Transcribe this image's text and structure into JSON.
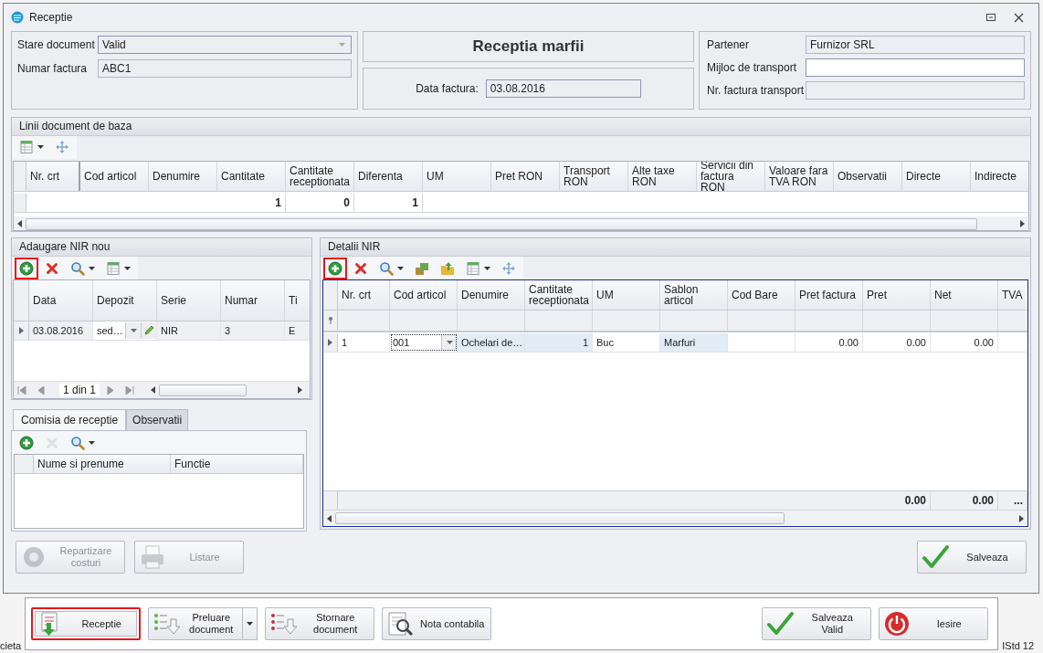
{
  "window": {
    "title": "Receptie"
  },
  "document": {
    "fields": [
      {
        "label": "Stare document",
        "value": "Valid",
        "kind": "dropdown"
      },
      {
        "label": "Numar factura",
        "value": "ABC1",
        "kind": "readonly"
      }
    ],
    "heading": "Receptia marfii",
    "date": {
      "label": "Data factura:",
      "value": "03.08.2016"
    },
    "partner_fields": [
      {
        "label": "Partener",
        "value": "Furnizor SRL",
        "kind": "readonly"
      },
      {
        "label": "Mijloc de transport",
        "kind": "editable"
      },
      {
        "label": "Nr. factura transport",
        "kind": "readonly"
      }
    ]
  },
  "base_lines": {
    "title": "Linii document de baza",
    "tools": [
      {
        "kind": "layout-menu",
        "highlighted": false,
        "disabled": false
      },
      {
        "kind": "move",
        "highlighted": false,
        "disabled": false
      }
    ],
    "columns": [
      {
        "label": "Nr. crt"
      },
      {
        "label": "Cod articol"
      },
      {
        "label": "Denumire"
      },
      {
        "label": "Cantitate",
        "total": "1"
      },
      {
        "label": "Cantitate receptionata",
        "total": "0"
      },
      {
        "label": "Diferenta",
        "total": "1"
      },
      {
        "label": "UM"
      },
      {
        "label": "Pret RON"
      },
      {
        "label": "Transport RON"
      },
      {
        "label": "Alte taxe RON"
      },
      {
        "label": "Servicii din factura RON"
      },
      {
        "label": "Valoare fara TVA RON"
      },
      {
        "label": "Observatii"
      },
      {
        "label": "Directe"
      },
      {
        "label": "Indirecte"
      }
    ]
  },
  "nir_list": {
    "title": "Adaugare NIR nou",
    "tools": [
      {
        "kind": "add",
        "highlighted": true,
        "disabled": false
      },
      {
        "kind": "delete",
        "highlighted": false,
        "disabled": false
      },
      {
        "kind": "search-menu",
        "highlighted": false,
        "disabled": false
      },
      {
        "kind": "layout-menu",
        "highlighted": false,
        "disabled": false
      }
    ],
    "columns": [
      "Data",
      "Depozit",
      "Serie",
      "Numar",
      "Ti"
    ],
    "rows": [
      {
        "selected": true,
        "cells": [
          {
            "text": "03.08.2016",
            "kind": "text"
          },
          {
            "text": "sed…",
            "kind": "lookup-edit"
          },
          {
            "text": "NIR",
            "kind": "text"
          },
          {
            "text": "3",
            "kind": "text"
          },
          {
            "text": "E",
            "kind": "text"
          }
        ]
      }
    ],
    "pager": "1 din 1"
  },
  "commission": {
    "tabs": [
      {
        "label": "Comisia de receptie",
        "selected": true
      },
      {
        "label": "Observatii",
        "selected": false
      }
    ],
    "tools": [
      {
        "kind": "add",
        "highlighted": false,
        "disabled": false
      },
      {
        "kind": "delete",
        "highlighted": false,
        "disabled": true
      },
      {
        "kind": "search-menu",
        "highlighted": false,
        "disabled": false
      }
    ],
    "columns": [
      "Nume si prenume",
      "Functie"
    ]
  },
  "nir_details": {
    "title": "Detalii NIR",
    "tools": [
      {
        "kind": "add",
        "highlighted": true,
        "disabled": false
      },
      {
        "kind": "delete",
        "highlighted": false,
        "disabled": false
      },
      {
        "kind": "search-menu",
        "highlighted": false,
        "disabled": false
      },
      {
        "kind": "import",
        "highlighted": false,
        "disabled": false
      },
      {
        "kind": "export",
        "highlighted": false,
        "disabled": false
      },
      {
        "kind": "layout-menu",
        "highlighted": false,
        "disabled": false
      },
      {
        "kind": "move",
        "highlighted": false,
        "disabled": false
      }
    ],
    "columns": [
      {
        "label": "Nr. crt"
      },
      {
        "label": "Cod articol"
      },
      {
        "label": "Denumire"
      },
      {
        "label": "Cantitate receptionata"
      },
      {
        "label": "UM"
      },
      {
        "label": "Sablon articol"
      },
      {
        "label": "Cod Bare"
      },
      {
        "label": "Pret factura"
      },
      {
        "label": "Pret",
        "total": "0.00"
      },
      {
        "label": "Net",
        "total": "0.00"
      },
      {
        "label": "TVA",
        "total": "..."
      }
    ],
    "rows": [
      {
        "selected": true,
        "cells": [
          {
            "text": "1",
            "kind": "text"
          },
          {
            "text": "001",
            "kind": "dropdown"
          },
          {
            "text": "Ochelari de…",
            "kind": "shaded"
          },
          {
            "text": "1",
            "kind": "shaded-number"
          },
          {
            "text": "Buc",
            "kind": "text"
          },
          {
            "text": "Marfuri",
            "kind": "shaded"
          },
          {
            "text": "",
            "kind": "text"
          },
          {
            "text": "0.00",
            "kind": "number"
          },
          {
            "text": "0.00",
            "kind": "number"
          },
          {
            "text": "0.00",
            "kind": "number"
          },
          {
            "text": "",
            "kind": "text"
          }
        ]
      }
    ],
    "has_filter_row": true
  },
  "actions": [
    {
      "label": "Repartizare costuri",
      "kind": "distribute",
      "disabled": true
    },
    {
      "label": "Listare",
      "kind": "print",
      "disabled": true
    },
    {
      "label": "Salveaza",
      "kind": "save",
      "disabled": false
    }
  ],
  "bottom_bar": [
    {
      "label": "Receptie",
      "kind": "receipt",
      "highlighted": true,
      "has_menu": false
    },
    {
      "label": "Preluare document",
      "kind": "import-document",
      "highlighted": false,
      "has_menu": true
    },
    {
      "label": "Stornare document",
      "kind": "reverse-document",
      "highlighted": false,
      "has_menu": false
    },
    {
      "label": "Nota contabila",
      "kind": "accounting-note",
      "highlighted": false,
      "has_menu": false
    },
    {
      "label": "Salveaza Valid",
      "kind": "save-valid",
      "highlighted": false,
      "has_menu": false
    },
    {
      "label": "Iesire",
      "kind": "exit",
      "highlighted": false,
      "has_menu": false
    }
  ],
  "background": {
    "left_text": "cieta",
    "right_text": "IStd 12"
  }
}
